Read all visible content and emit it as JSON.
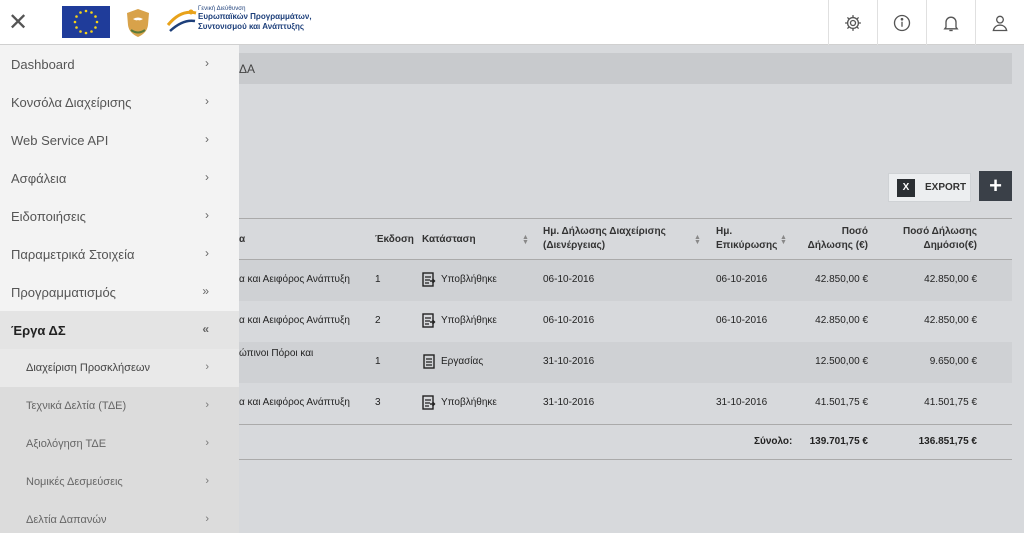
{
  "header": {
    "close_glyph": "✕",
    "logo_line1": "Γενική Διεύθυνση",
    "logo_line2": "Ευρωπαϊκών Προγραμμάτων,",
    "logo_line3": "Συντονισμού και Ανάπτυξης",
    "icons": [
      "gear-icon",
      "info-icon",
      "bell-icon",
      "user-icon"
    ]
  },
  "breadcrumb": "ΔΑ",
  "toolbar": {
    "export_label": "EXPORT",
    "export_icon": "X",
    "add_label": "+"
  },
  "table": {
    "headers": {
      "title": "α",
      "version": "Έκδοση",
      "status": "Κατάσταση",
      "decl_date_l1": "Ημ. Δήλωσης Διαχείρισης",
      "decl_date_l2": "(Διενέργειας)",
      "confirm_date_l1": "Ημ.",
      "confirm_date_l2": "Επικύρωσης",
      "amount_l1": "Ποσό",
      "amount_l2": "Δήλωσης (€)",
      "public_l1": "Ποσό Δήλωσης",
      "public_l2": "Δημόσιο(€)"
    },
    "rows": [
      {
        "title": "α και Αειφόρος Ανάπτυξη",
        "version": "1",
        "status": "Υποβλήθηκε",
        "decl_date": "06-10-2016",
        "confirm_date": "06-10-2016",
        "amount": "42.850,00 €",
        "public": "42.850,00 €"
      },
      {
        "title": "α και Αειφόρος Ανάπτυξη",
        "version": "2",
        "status": "Υποβλήθηκε",
        "decl_date": "06-10-2016",
        "confirm_date": "06-10-2016",
        "amount": "42.850,00 €",
        "public": "42.850,00 €"
      },
      {
        "title": "ώπινοι Πόροι και",
        "version": "1",
        "status": "Εργασίας",
        "decl_date": "31-10-2016",
        "confirm_date": "",
        "amount": "12.500,00 €",
        "public": "9.650,00 €"
      },
      {
        "title": "α και Αειφόρος Ανάπτυξη",
        "version": "3",
        "status": "Υποβλήθηκε",
        "decl_date": "31-10-2016",
        "confirm_date": "31-10-2016",
        "amount": "41.501,75 €",
        "public": "41.501,75 €"
      }
    ],
    "footer": {
      "label": "Σύνολο:",
      "amount": "139.701,75 €",
      "public": "136.851,75 €"
    }
  },
  "sidebar": {
    "items": [
      {
        "label": "Dashboard",
        "chev": "›"
      },
      {
        "label": "Κονσόλα Διαχείρισης",
        "chev": "›"
      },
      {
        "label": "Web Service API",
        "chev": "›"
      },
      {
        "label": "Ασφάλεια",
        "chev": "›"
      },
      {
        "label": "Ειδοποιήσεις",
        "chev": "›"
      },
      {
        "label": "Παραμετρικά Στοιχεία",
        "chev": "›"
      },
      {
        "label": "Προγραμματισμός",
        "chev": "»"
      },
      {
        "label": "Έργα ΔΣ",
        "chev": "«"
      }
    ],
    "subitems": [
      {
        "label": "Διαχείριση Προσκλήσεων",
        "chev": "›"
      },
      {
        "label": "Τεχνικά Δελτία (ΤΔΕ)",
        "chev": "›"
      },
      {
        "label": "Αξιολόγηση ΤΔΕ",
        "chev": "›"
      },
      {
        "label": "Νομικές Δεσμεύσεις",
        "chev": "›"
      },
      {
        "label": "Δελτία Δαπανών",
        "chev": "›"
      }
    ]
  }
}
